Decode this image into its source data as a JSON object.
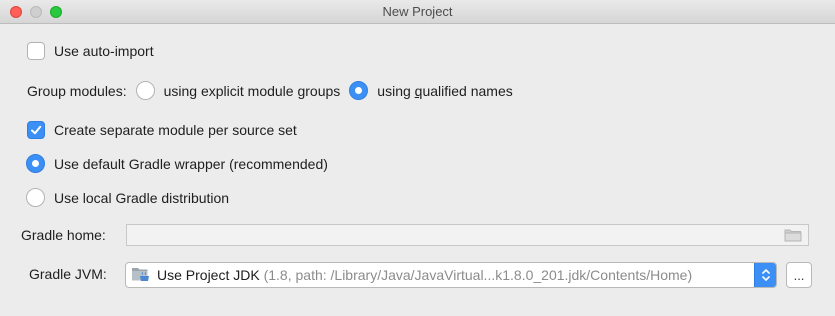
{
  "window": {
    "title": "New Project"
  },
  "options": {
    "auto_import": {
      "label": "Use auto-import",
      "checked": false
    },
    "group_modules": {
      "label": "Group modules:",
      "option_explicit": {
        "pre": "using explicit module ",
        "ul": "g",
        "post": "roups",
        "selected": false
      },
      "option_qualified": {
        "pre": "using ",
        "ul": "q",
        "post": "ualified names",
        "selected": true
      }
    },
    "separate_module": {
      "label": "Create separate module per source set",
      "checked": true
    },
    "default_wrapper": {
      "label": "Use default Gradle wrapper (recommended)",
      "selected": true
    },
    "local_distribution": {
      "label": "Use local Gradle distribution",
      "selected": false
    }
  },
  "gradle_home": {
    "label": "Gradle home:",
    "value": "",
    "icon": "folder-icon"
  },
  "gradle_jvm": {
    "label": "Gradle JVM:",
    "selected_name": "Use Project JDK",
    "selected_detail": " (1.8, path: /Library/Java/JavaVirtual...k1.8.0_201.jdk/Contents/Home)",
    "browse_label": "..."
  },
  "colors": {
    "accent": "#3c8ff5",
    "background": "#ececec"
  }
}
